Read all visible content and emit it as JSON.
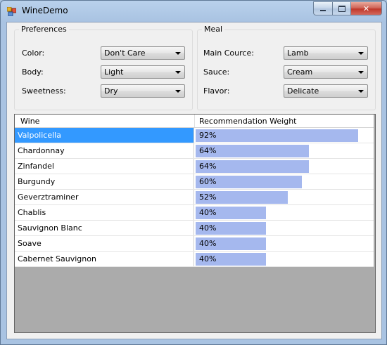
{
  "window": {
    "title": "WineDemo"
  },
  "preferences": {
    "title": "Preferences",
    "fields": [
      {
        "label": "Color:",
        "value": "Don't Care"
      },
      {
        "label": "Body:",
        "value": "Light"
      },
      {
        "label": "Sweetness:",
        "value": "Dry"
      }
    ]
  },
  "meal": {
    "title": "Meal",
    "fields": [
      {
        "label": "Main Cource:",
        "value": "Lamb"
      },
      {
        "label": "Sauce:",
        "value": "Cream"
      },
      {
        "label": "Flavor:",
        "value": "Delicate"
      }
    ]
  },
  "grid": {
    "columns": [
      "Wine",
      "Recommendation Weight"
    ],
    "selected_index": 0,
    "rows": [
      {
        "wine": "Valpolicella",
        "weight": "92%",
        "pct": 92
      },
      {
        "wine": "Chardonnay",
        "weight": "64%",
        "pct": 64
      },
      {
        "wine": "Zinfandel",
        "weight": "64%",
        "pct": 64
      },
      {
        "wine": "Burgundy",
        "weight": "60%",
        "pct": 60
      },
      {
        "wine": "Geverztraminer",
        "weight": "52%",
        "pct": 52
      },
      {
        "wine": "Chablis",
        "weight": "40%",
        "pct": 40
      },
      {
        "wine": "Sauvignon Blanc",
        "weight": "40%",
        "pct": 40
      },
      {
        "wine": "Soave",
        "weight": "40%",
        "pct": 40
      },
      {
        "wine": "Cabernet Sauvignon",
        "weight": "40%",
        "pct": 40
      }
    ]
  },
  "colors": {
    "selection": "#3399ff",
    "bar": "#a5b8ee",
    "grid_background": "#ababab"
  }
}
